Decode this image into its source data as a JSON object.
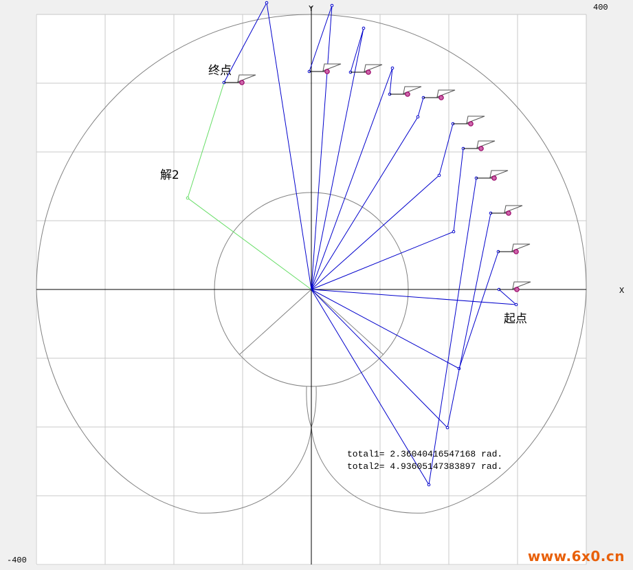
{
  "axes": {
    "x_label": "X",
    "y_label": "Y",
    "max_label": "400",
    "min_label": "-400",
    "xlim": [
      -400,
      400
    ],
    "ylim": [
      -400,
      400
    ],
    "grid_step": 100
  },
  "labels": {
    "end_point": "终点",
    "start_point": "起点",
    "solution2": "解2"
  },
  "results": {
    "total1": "total1= 2.36040416547168 rad.",
    "total2": "total2= 4.93605147383897 rad."
  },
  "watermark": "www.6x0.cn",
  "colors": {
    "grid": "#c8c8c8",
    "axis": "#000000",
    "boundary": "#808080",
    "arm_solution1": "#0000cc",
    "arm_solution2": "#66dd66",
    "tool_marker": "#990066",
    "background": "#ffffff"
  },
  "chart_data": {
    "type": "diagram",
    "workspace": {
      "outer_radius": 400,
      "inner_radius": 141,
      "lobe_bottom": -400
    },
    "arm_solution1": [
      {
        "joint": [
          298,
          -22
        ],
        "tip": [
          273,
          0
        ]
      },
      {
        "joint": [
          215,
          -115
        ],
        "tip": [
          272,
          55
        ]
      },
      {
        "joint": [
          198,
          -201
        ],
        "tip": [
          261,
          111
        ]
      },
      {
        "joint": [
          171,
          -284
        ],
        "tip": [
          240,
          162
        ]
      },
      {
        "joint": [
          207,
          84
        ],
        "tip": [
          221,
          205
        ]
      },
      {
        "joint": [
          186,
          166
        ],
        "tip": [
          206,
          241
        ]
      },
      {
        "joint": [
          155,
          251
        ],
        "tip": [
          163,
          279
        ]
      },
      {
        "joint": [
          118,
          322
        ],
        "tip": [
          114,
          284
        ]
      },
      {
        "joint": [
          76,
          380
        ],
        "tip": [
          57,
          316
        ]
      },
      {
        "joint": [
          30,
          413
        ],
        "tip": [
          -3,
          317
        ]
      },
      {
        "joint": [
          -65,
          417
        ],
        "tip": [
          -127,
          301
        ]
      }
    ],
    "arm_solution2": [
      {
        "joint": [
          -180,
          133
        ],
        "tip": [
          -127,
          301
        ]
      }
    ]
  }
}
